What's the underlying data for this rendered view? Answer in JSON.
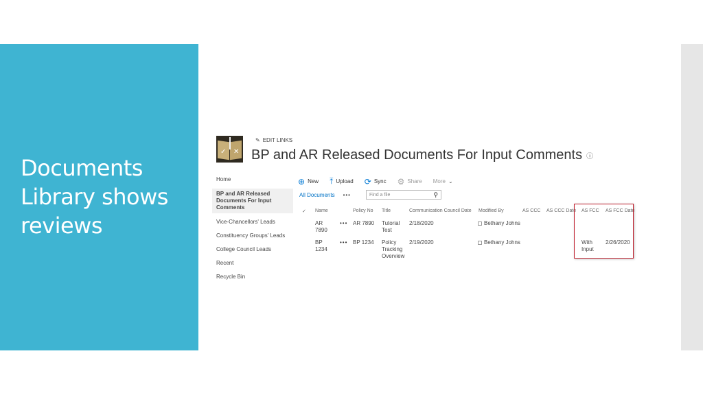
{
  "slide": {
    "title_lines": [
      "Documents",
      "Library shows",
      "reviews"
    ],
    "band_color": "#3fb4d2"
  },
  "site": {
    "edit_links": "EDIT LINKS",
    "page_title": "BP and AR Released Documents For Input Comments",
    "info_glyph": "ⓘ"
  },
  "nav": {
    "items": [
      {
        "label": "Home"
      },
      {
        "label": "BP and AR Released Documents For Input Comments",
        "selected": true
      },
      {
        "label": "Vice-Chancellors' Leads"
      },
      {
        "label": "Constituency Groups' Leads"
      },
      {
        "label": "College Council Leads"
      },
      {
        "label": "Recent"
      },
      {
        "label": "Recycle Bin"
      }
    ]
  },
  "commands": {
    "new": "New",
    "upload": "Upload",
    "sync": "Sync",
    "share": "Share",
    "more": "More"
  },
  "view": {
    "all_documents": "All Documents",
    "dots": "•••",
    "search_placeholder": "Find a file"
  },
  "table": {
    "headers": {
      "check": "✓",
      "name": "Name",
      "policy_no": "Policy No",
      "title": "Title",
      "comm_date": "Communication Council Date",
      "modified_by": "Modified By",
      "as_ccc": "AS CCC",
      "as_ccc_date": "AS CCC Date",
      "as_fcc": "AS FCC",
      "as_fcc_date": "AS FCC Date"
    },
    "rows": [
      {
        "name": "AR 7890",
        "more": "•••",
        "policy_no": "AR 7890",
        "title": "Tutorial Test",
        "comm_date": "2/18/2020",
        "modified_by": "Bethany Johns",
        "as_fcc": "",
        "as_fcc_date": ""
      },
      {
        "name": "BP 1234",
        "more": "•••",
        "policy_no": "BP 1234",
        "title": "Policy Tracking Overview",
        "comm_date": "2/19/2020",
        "modified_by": "Bethany Johns",
        "as_fcc": "With Input",
        "as_fcc_date": "2/26/2020"
      }
    ]
  },
  "colors": {
    "highlight": "#c0202e",
    "link": "#0072c6"
  }
}
